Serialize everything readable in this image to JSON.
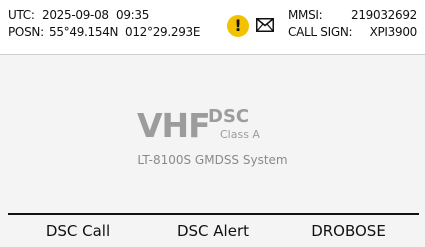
{
  "header": {
    "utc_label": "UTC:",
    "utc_date": "2025-09-08",
    "utc_time": "09:35",
    "posn_label": "POSN:",
    "posn_lat": "55°49.154N",
    "posn_lon": "012°29.293E",
    "mmsi_label": "MMSI:",
    "mmsi_value": "219032692",
    "callsign_label": "CALL SIGN:",
    "callsign_value": "XPI3900",
    "alert_icon": "!"
  },
  "logo": {
    "vhf": "VHF",
    "dsc": "DSC",
    "class": "Class A",
    "system": "LT-8100S GMDSS System"
  },
  "softkeys": {
    "left": "DSC Call",
    "middle": "DSC Alert",
    "right": "DROBOSE"
  },
  "colors": {
    "alert": "#f2c200",
    "logo_gray": "#9c9c9c"
  },
  "icons": [
    "warning-icon",
    "envelope-icon"
  ]
}
